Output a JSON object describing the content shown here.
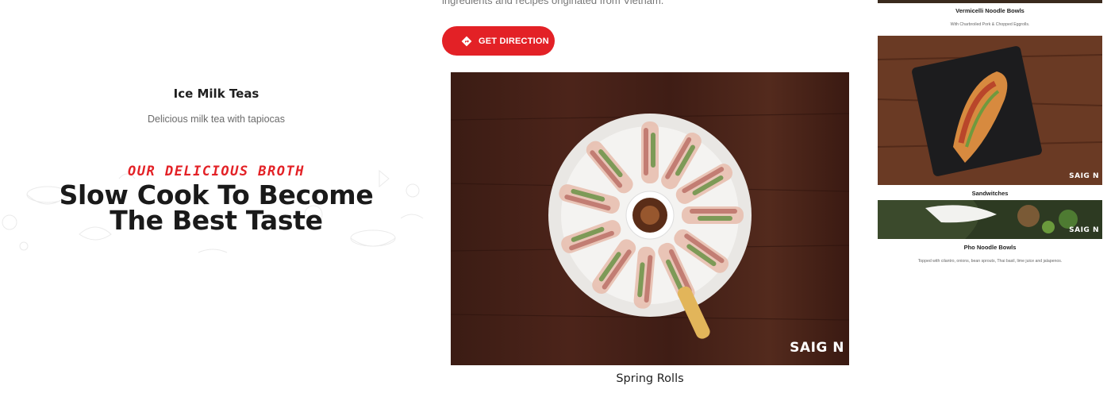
{
  "intro": {
    "text": "ingredients and recipes originated from Vietnam."
  },
  "direction_button": {
    "label": "GET DIRECTION",
    "icon": "direction-icon"
  },
  "left_item": {
    "title": "Ice Milk Teas",
    "description": "Delicious milk tea with tapiocas"
  },
  "broth_section": {
    "eyebrow": "OUR DELICIOUS BROTH",
    "headline": "Slow Cook To Become The Best Taste"
  },
  "main_item": {
    "caption": "Spring Rolls",
    "watermark": "SAIG  N"
  },
  "menu_items": [
    {
      "title": "Vermicelli Noodle Bowls",
      "description": "With Charbroiled Pork & Chopped Eggrolls."
    },
    {
      "title": "Sandwitches",
      "description": ""
    },
    {
      "title": "Pho Noodle Bowls",
      "description": "Topped with cilantro, onions, bean sprouts, Thai basil, lime juice and jalapenos."
    }
  ],
  "colors": {
    "accent": "#e32126",
    "heading": "#1a1a1a",
    "muted": "#6b6b6b"
  }
}
